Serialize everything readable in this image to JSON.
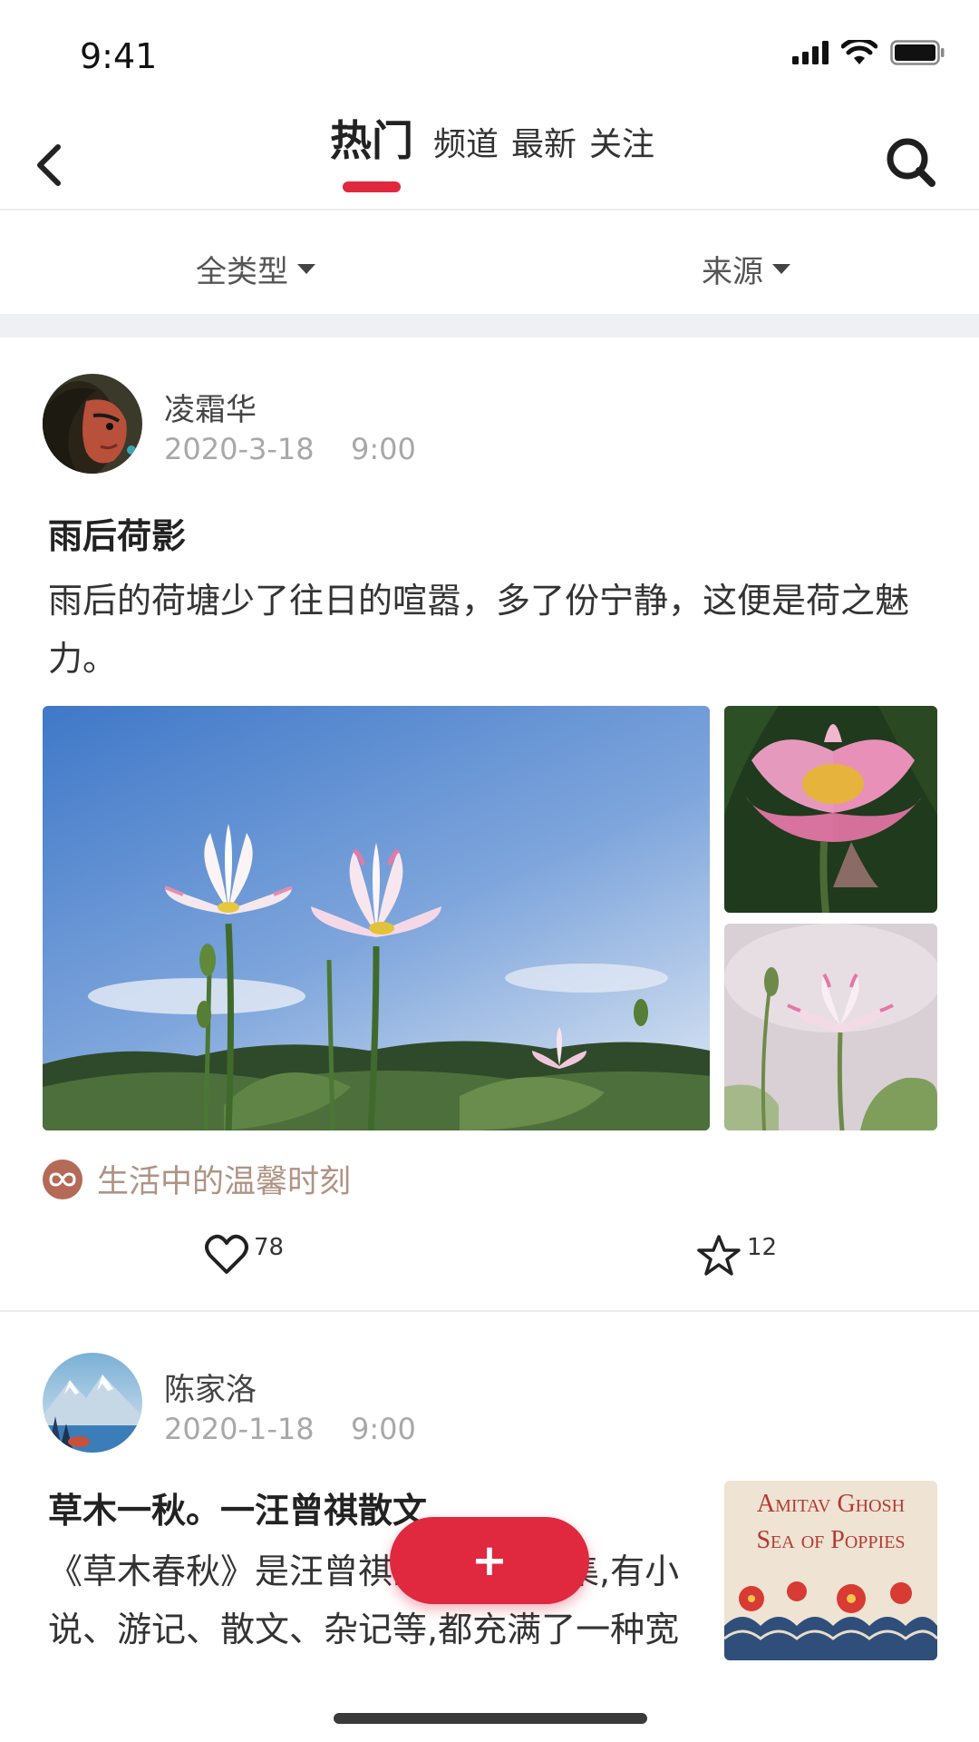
{
  "status": {
    "time": "9:41"
  },
  "nav": {
    "tabs": [
      {
        "label": "热门",
        "active": true
      },
      {
        "label": "频道",
        "active": false
      },
      {
        "label": "最新",
        "active": false
      },
      {
        "label": "关注",
        "active": false
      }
    ],
    "accent": "#e0283f"
  },
  "filters": [
    {
      "label": "全类型"
    },
    {
      "label": "来源"
    }
  ],
  "posts": [
    {
      "author": "凌霜华",
      "date": "2020-3-18",
      "time": "9:00",
      "title": "雨后荷影",
      "body": "雨后的荷塘少了往日的喧嚣，多了份宁静，这便是荷之魅力。",
      "tag": "生活中的温馨时刻",
      "likes": "78",
      "favorites": "12"
    },
    {
      "author": "陈家洛",
      "date": "2020-1-18",
      "time": "9:00",
      "title": "草木一秋。一汪曾祺散文",
      "body": "《草木春秋》是汪曾祺的一个作品集,有小说、游记、散文、杂记等,都充满了一种宽和温暖自身的清高",
      "book_cover": {
        "line1": "Amitav Ghosh",
        "line2": "Sea of Poppies"
      }
    }
  ],
  "fab": {
    "label": "+"
  }
}
